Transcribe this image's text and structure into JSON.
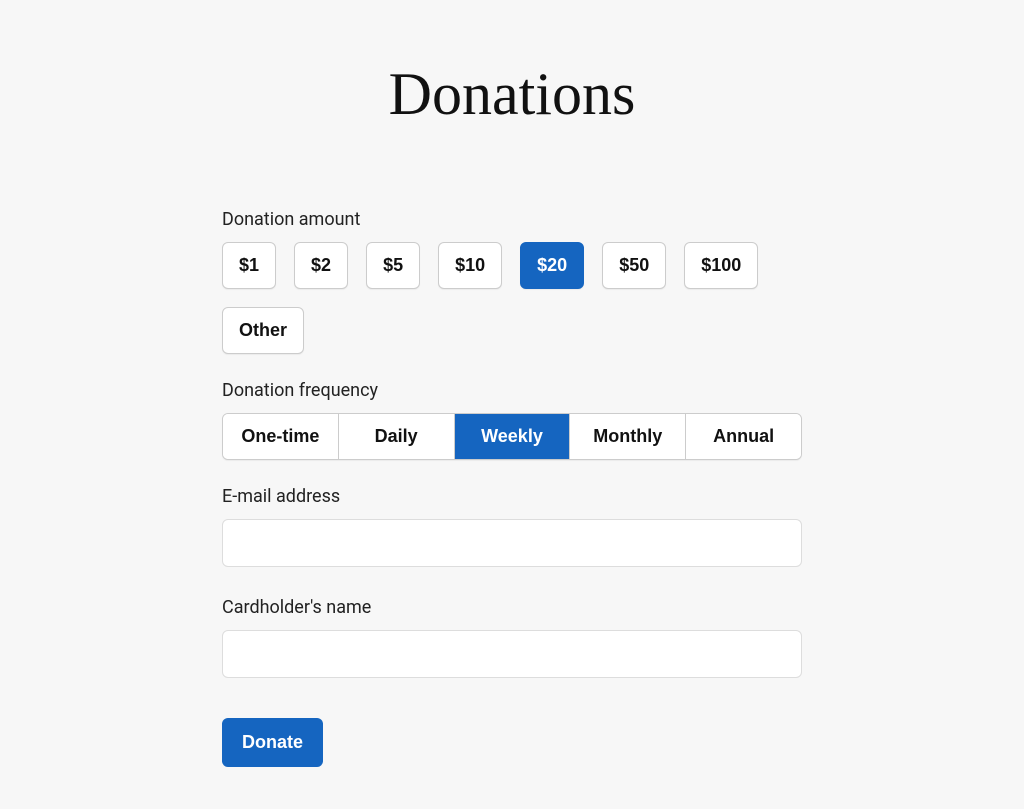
{
  "title": "Donations",
  "amount": {
    "label": "Donation amount",
    "options": [
      "$1",
      "$2",
      "$5",
      "$10",
      "$20",
      "$50",
      "$100",
      "Other"
    ],
    "selected_index": 4
  },
  "frequency": {
    "label": "Donation frequency",
    "options": [
      "One-time",
      "Daily",
      "Weekly",
      "Monthly",
      "Annual"
    ],
    "selected_index": 2
  },
  "email": {
    "label": "E-mail address",
    "value": ""
  },
  "cardholder": {
    "label": "Cardholder's name",
    "value": ""
  },
  "submit_label": "Donate"
}
